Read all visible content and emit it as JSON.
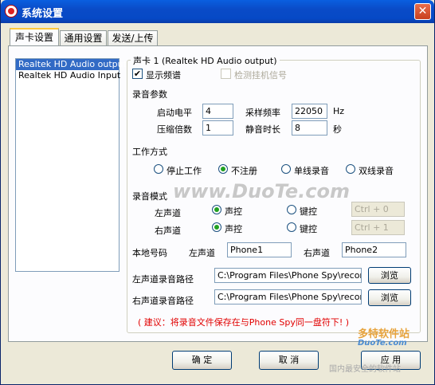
{
  "window": {
    "title": "系统设置",
    "close": "✕"
  },
  "tabs": [
    "声卡设置",
    "通用设置",
    "发送/上传"
  ],
  "devices": [
    "Realtek HD Audio output",
    "Realtek HD Audio Input"
  ],
  "group_title": "声卡 1 (Realtek HD Audio output)",
  "show_spectrum": {
    "label": "显示频谱",
    "checked": "✔"
  },
  "detect_hook": {
    "label": "检测挂机信号"
  },
  "record_params": {
    "heading": "录音参数",
    "start_level_label": "启动电平",
    "start_level": "4",
    "sample_rate_label": "采样频率",
    "sample_rate": "22050",
    "sample_rate_unit": "Hz",
    "compress_label": "压缩倍数",
    "compress": "1",
    "silence_label": "静音时长",
    "silence": "8",
    "silence_unit": "秒"
  },
  "work_mode": {
    "heading": "工作方式",
    "options": [
      "停止工作",
      "不注册",
      "单线录音",
      "双线录音"
    ]
  },
  "record_mode": {
    "heading": "录音模式",
    "left_label": "左声道",
    "right_label": "右声道",
    "voice": "声控",
    "key": "键控",
    "left_key": "Ctrl + 0",
    "right_key": "Ctrl + 1"
  },
  "local_number": {
    "heading": "本地号码",
    "left_label": "左声道",
    "left_value": "Phone1",
    "right_label": "右声道",
    "right_value": "Phone2"
  },
  "paths": {
    "left_label": "左声道录音路径",
    "left_value": "C:\\Program Files\\Phone Spy\\record\\",
    "right_label": "右声道录音路径",
    "right_value": "C:\\Program Files\\Phone Spy\\record\\",
    "browse": "浏览"
  },
  "hint": "( 建议：将录音文件保存在与Phone Spy同一盘符下! )",
  "buttons": {
    "ok": "确 定",
    "cancel": "取 消",
    "apply": "应 用"
  },
  "watermark": {
    "main": "www.DuoTe.com",
    "site": "多特软件站",
    "site2": "DuoTe.com",
    "tag": "国内最安全的软件站"
  }
}
